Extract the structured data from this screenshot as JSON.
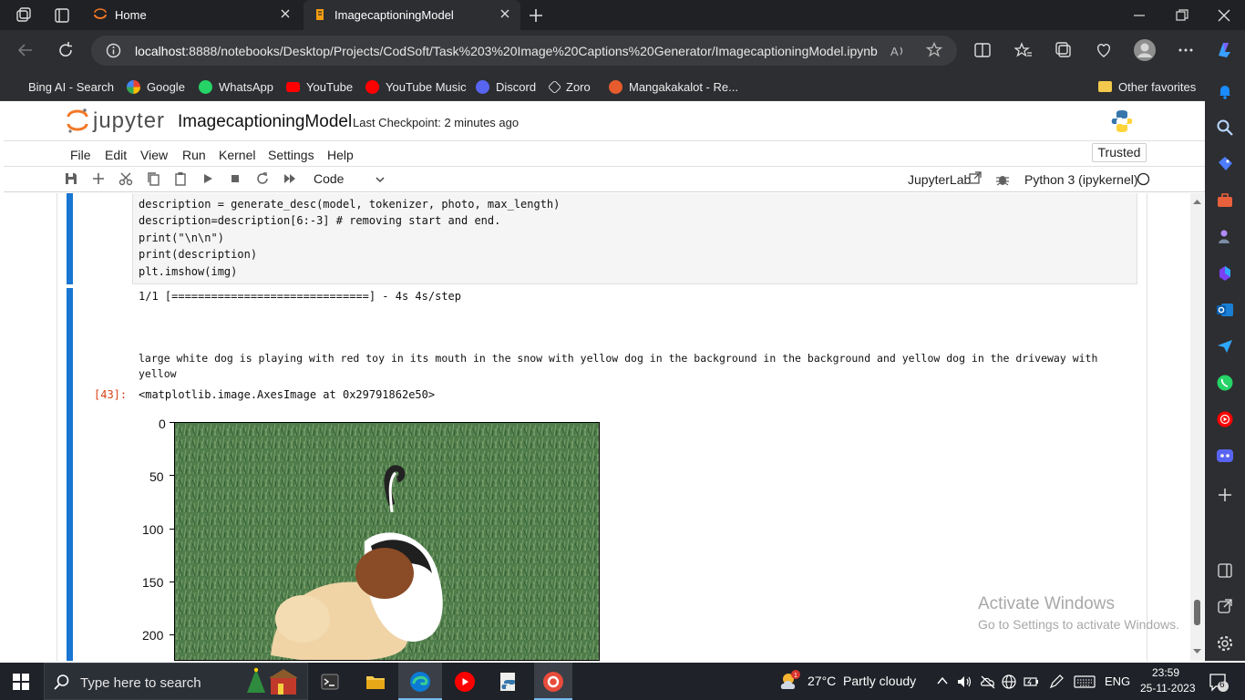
{
  "browser": {
    "tabs": [
      {
        "label": "Home"
      },
      {
        "label": "ImagecaptioningModel"
      }
    ],
    "address": {
      "host": "localhost",
      "rest": ":8888/notebooks/Desktop/Projects/CodSoft/Task%203%20Image%20Captions%20Generator/ImagecaptioningModel.ipynb"
    },
    "favorites": [
      {
        "label": "Bing AI - Search",
        "color": "#1a73e8"
      },
      {
        "label": "Google",
        "color": "#ffffff"
      },
      {
        "label": "WhatsApp",
        "color": "#25d366"
      },
      {
        "label": "YouTube",
        "color": "#ff0000"
      },
      {
        "label": "YouTube Music",
        "color": "#ff0000"
      },
      {
        "label": "Discord",
        "color": "#5865f2"
      },
      {
        "label": "Zoro",
        "color": "#dddddd"
      },
      {
        "label": "Mangakakalot - Re...",
        "color": "#e65c2e"
      }
    ],
    "other_favorites": "Other favorites"
  },
  "jupyter": {
    "logo": "jupyter",
    "notebook_name": "ImagecaptioningModel",
    "checkpoint": "Last Checkpoint: 2 minutes ago",
    "trusted": "Trusted",
    "menu": [
      "File",
      "Edit",
      "View",
      "Run",
      "Kernel",
      "Settings",
      "Help"
    ],
    "cell_type": "Code",
    "jupyterlab_link": "JupyterLab",
    "kernel": "Python 3 (ipykernel)"
  },
  "cell": {
    "code": [
      "description = generate_desc(model, tokenizer, photo, max_length)",
      "description=description[6:-3] # removing start and end.",
      "print(\"\\n\\n\")",
      "print(description)",
      "plt.imshow(img)"
    ],
    "progress_line": "1/1 [==============================] - 4s 4s/step",
    "caption_line1": "large white dog is playing with red toy in its mouth in the snow with yellow dog in the background in the background and yellow dog in the driveway with",
    "caption_line2": "yellow",
    "out_prompt": "[43]:",
    "out_repr": "<matplotlib.image.AxesImage at 0x29791862e50>",
    "y_ticks": [
      "0",
      "50",
      "100",
      "150",
      "200"
    ]
  },
  "watermark": {
    "title": "Activate Windows",
    "subtitle": "Go to Settings to activate Windows."
  },
  "taskbar": {
    "search_placeholder": "Type here to search",
    "weather_temp": "27°C",
    "weather_text": "Partly cloudy",
    "lang": "ENG",
    "time": "23:59",
    "date": "25-11-2023",
    "notif_count": "6"
  }
}
